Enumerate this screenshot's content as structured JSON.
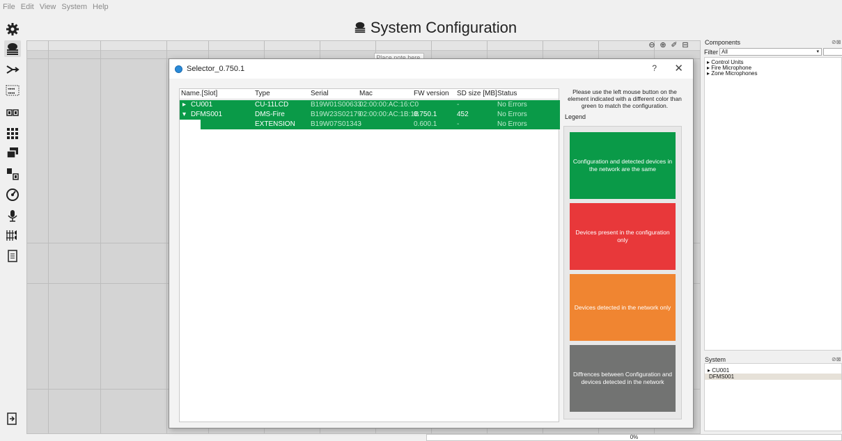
{
  "menu": [
    "File",
    "Edit",
    "View",
    "System",
    "Help"
  ],
  "title": "System Configuration",
  "note": "Place note here.",
  "dialog": {
    "title": "Selector_0.750.1",
    "help": "?",
    "close": "✕",
    "columns": [
      "Name.[Slot]",
      "Type",
      "Serial",
      "Mac",
      "FW version",
      "SD size [MB]",
      "Status"
    ],
    "rows": [
      {
        "expander": "▸",
        "name": "CU001",
        "type": "CU-11LCD",
        "serial": "B19W01S00633",
        "mac": "02:00:00:AC:16:C0",
        "fw": "",
        "sd": "-",
        "status": "No Errors"
      },
      {
        "expander": "▾",
        "name": "DFMS001",
        "type": "DMS-Fire",
        "serial": "B19W23S02179",
        "mac": "02:00:00:AC:1B:1B",
        "fw": "0.750.1",
        "sd": "452",
        "status": "No Errors"
      },
      {
        "expander": "",
        "name": "",
        "type": "EXTENSION",
        "serial": "B19W07S01343",
        "mac": "-",
        "fw": "0.600.1",
        "sd": "-",
        "status": "No Errors"
      }
    ],
    "instructions": "Please use the left mouse button on the element indicated with a different color than green to match the configuration.",
    "legend_label": "Legend",
    "legend": [
      {
        "text": "Configuration and detected devices in the network are the same",
        "color": "#0a9a48"
      },
      {
        "text": "Devices present in the configuration only",
        "color": "#e8383a"
      },
      {
        "text": "Devices detected in the network only",
        "color": "#f08531"
      },
      {
        "text": "Diffrences between Configuration and devices detected in the network",
        "color": "#727372"
      }
    ]
  },
  "components": {
    "title": "Components",
    "filter_label": "Filter",
    "filter_value": "All",
    "items": [
      "▸ Control Units",
      "▸ Fire Microphone",
      "▸ Zone Microphones"
    ]
  },
  "system": {
    "title": "System",
    "items": [
      "▸ CU001",
      "DFMS001"
    ]
  },
  "progress": "0%",
  "colors": {
    "green": "#0a9a48",
    "red": "#e8383a",
    "orange": "#f08531",
    "grey": "#727372"
  }
}
